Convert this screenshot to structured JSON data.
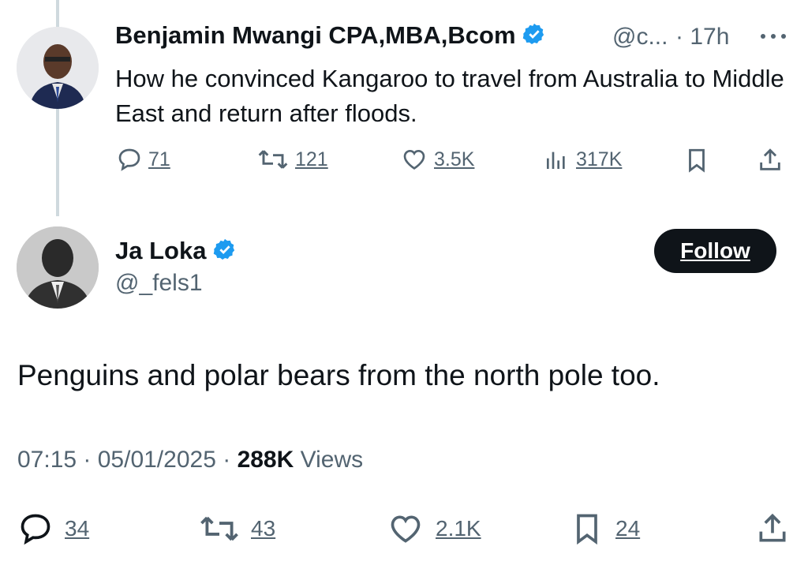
{
  "reply_to": {
    "author_name": "Benjamin Mwangi CPA,MBA,Bcom",
    "handle": "@c...",
    "time": "· 17h",
    "text": "How he convinced Kangaroo to travel from Australia to Middle East and return after floods.",
    "replies": "71",
    "reposts": "121",
    "likes": "3.5K",
    "views": "317K"
  },
  "tweet": {
    "author_name": "Ja Loka",
    "handle": "@_fels1",
    "follow_label": "Follow",
    "text": "Penguins and polar bears from the north pole too.",
    "timestamp": "07:15 · 05/01/2025 ·",
    "views_count": "288K",
    "views_label": "Views",
    "replies": "34",
    "reposts": "43",
    "likes": "2.1K",
    "bookmarks": "24"
  },
  "colors": {
    "verified": "#1d9bf0",
    "secondary_text": "#536471",
    "primary_text": "#0f1419",
    "thread_line": "#cfd9de"
  }
}
